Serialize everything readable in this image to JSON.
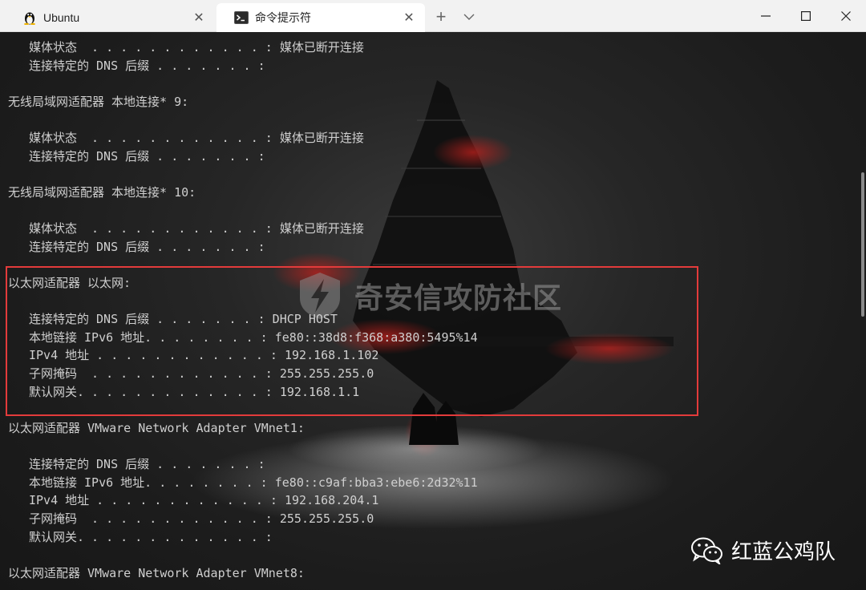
{
  "tabs": [
    {
      "label": "Ubuntu",
      "icon": "linux-penguin-icon",
      "active": false
    },
    {
      "label": "命令提示符",
      "icon": "terminal-icon",
      "active": true
    }
  ],
  "window_controls": {
    "new_tab": "+",
    "minimize": "minimize-icon",
    "maximize": "maximize-icon",
    "close": "close-icon"
  },
  "terminal": {
    "lines": [
      "媒体状态  . . . . . . . . . . . . : 媒体已断开连接",
      "连接特定的 DNS 后缀 . . . . . . . :",
      "无线局域网适配器 本地连接* 9:",
      "媒体状态  . . . . . . . . . . . . : 媒体已断开连接",
      "连接特定的 DNS 后缀 . . . . . . . :",
      "无线局域网适配器 本地连接* 10:",
      "媒体状态  . . . . . . . . . . . . : 媒体已断开连接",
      "连接特定的 DNS 后缀 . . . . . . . :",
      "以太网适配器 以太网:",
      "连接特定的 DNS 后缀 . . . . . . . : DHCP HOST",
      "本地链接 IPv6 地址. . . . . . . . : fe80::38d8:f368:a380:5495%14",
      "IPv4 地址 . . . . . . . . . . . . : 192.168.1.102",
      "子网掩码  . . . . . . . . . . . . : 255.255.255.0",
      "默认网关. . . . . . . . . . . . . : 192.168.1.1",
      "以太网适配器 VMware Network Adapter VMnet1:",
      "连接特定的 DNS 后缀 . . . . . . . :",
      "本地链接 IPv6 地址. . . . . . . . : fe80::c9af:bba3:ebe6:2d32%11",
      "IPv4 地址 . . . . . . . . . . . . : 192.168.204.1",
      "子网掩码  . . . . . . . . . . . . : 255.255.255.0",
      "默认网关. . . . . . . . . . . . . :",
      "以太网适配器 VMware Network Adapter VMnet8:"
    ]
  },
  "watermark": {
    "text": "奇安信攻防社区"
  },
  "brand": {
    "text": "红蓝公鸡队",
    "icon": "wechat-icon"
  },
  "colors": {
    "highlight": "#e33b3b",
    "text": "#cfcfcf",
    "background": "#1c1c1c"
  }
}
